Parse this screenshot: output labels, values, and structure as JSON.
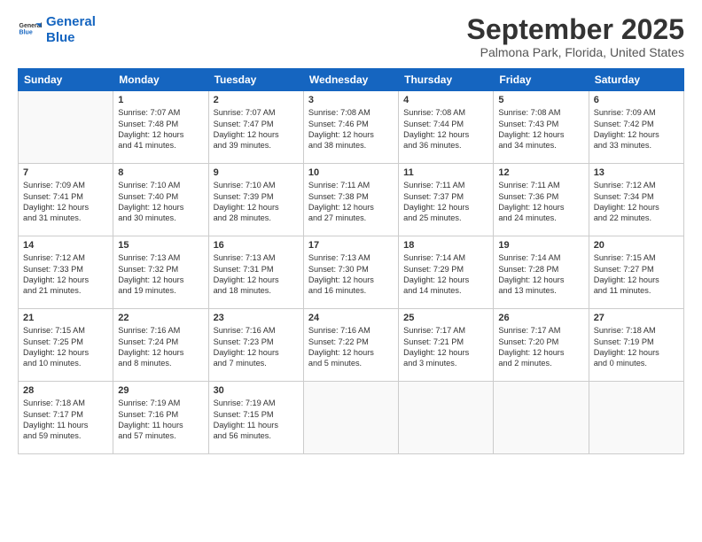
{
  "header": {
    "logo_line1": "General",
    "logo_line2": "Blue",
    "month": "September 2025",
    "location": "Palmona Park, Florida, United States"
  },
  "weekdays": [
    "Sunday",
    "Monday",
    "Tuesday",
    "Wednesday",
    "Thursday",
    "Friday",
    "Saturday"
  ],
  "weeks": [
    [
      {
        "day": "",
        "info": ""
      },
      {
        "day": "1",
        "info": "Sunrise: 7:07 AM\nSunset: 7:48 PM\nDaylight: 12 hours\nand 41 minutes."
      },
      {
        "day": "2",
        "info": "Sunrise: 7:07 AM\nSunset: 7:47 PM\nDaylight: 12 hours\nand 39 minutes."
      },
      {
        "day": "3",
        "info": "Sunrise: 7:08 AM\nSunset: 7:46 PM\nDaylight: 12 hours\nand 38 minutes."
      },
      {
        "day": "4",
        "info": "Sunrise: 7:08 AM\nSunset: 7:44 PM\nDaylight: 12 hours\nand 36 minutes."
      },
      {
        "day": "5",
        "info": "Sunrise: 7:08 AM\nSunset: 7:43 PM\nDaylight: 12 hours\nand 34 minutes."
      },
      {
        "day": "6",
        "info": "Sunrise: 7:09 AM\nSunset: 7:42 PM\nDaylight: 12 hours\nand 33 minutes."
      }
    ],
    [
      {
        "day": "7",
        "info": "Sunrise: 7:09 AM\nSunset: 7:41 PM\nDaylight: 12 hours\nand 31 minutes."
      },
      {
        "day": "8",
        "info": "Sunrise: 7:10 AM\nSunset: 7:40 PM\nDaylight: 12 hours\nand 30 minutes."
      },
      {
        "day": "9",
        "info": "Sunrise: 7:10 AM\nSunset: 7:39 PM\nDaylight: 12 hours\nand 28 minutes."
      },
      {
        "day": "10",
        "info": "Sunrise: 7:11 AM\nSunset: 7:38 PM\nDaylight: 12 hours\nand 27 minutes."
      },
      {
        "day": "11",
        "info": "Sunrise: 7:11 AM\nSunset: 7:37 PM\nDaylight: 12 hours\nand 25 minutes."
      },
      {
        "day": "12",
        "info": "Sunrise: 7:11 AM\nSunset: 7:36 PM\nDaylight: 12 hours\nand 24 minutes."
      },
      {
        "day": "13",
        "info": "Sunrise: 7:12 AM\nSunset: 7:34 PM\nDaylight: 12 hours\nand 22 minutes."
      }
    ],
    [
      {
        "day": "14",
        "info": "Sunrise: 7:12 AM\nSunset: 7:33 PM\nDaylight: 12 hours\nand 21 minutes."
      },
      {
        "day": "15",
        "info": "Sunrise: 7:13 AM\nSunset: 7:32 PM\nDaylight: 12 hours\nand 19 minutes."
      },
      {
        "day": "16",
        "info": "Sunrise: 7:13 AM\nSunset: 7:31 PM\nDaylight: 12 hours\nand 18 minutes."
      },
      {
        "day": "17",
        "info": "Sunrise: 7:13 AM\nSunset: 7:30 PM\nDaylight: 12 hours\nand 16 minutes."
      },
      {
        "day": "18",
        "info": "Sunrise: 7:14 AM\nSunset: 7:29 PM\nDaylight: 12 hours\nand 14 minutes."
      },
      {
        "day": "19",
        "info": "Sunrise: 7:14 AM\nSunset: 7:28 PM\nDaylight: 12 hours\nand 13 minutes."
      },
      {
        "day": "20",
        "info": "Sunrise: 7:15 AM\nSunset: 7:27 PM\nDaylight: 12 hours\nand 11 minutes."
      }
    ],
    [
      {
        "day": "21",
        "info": "Sunrise: 7:15 AM\nSunset: 7:25 PM\nDaylight: 12 hours\nand 10 minutes."
      },
      {
        "day": "22",
        "info": "Sunrise: 7:16 AM\nSunset: 7:24 PM\nDaylight: 12 hours\nand 8 minutes."
      },
      {
        "day": "23",
        "info": "Sunrise: 7:16 AM\nSunset: 7:23 PM\nDaylight: 12 hours\nand 7 minutes."
      },
      {
        "day": "24",
        "info": "Sunrise: 7:16 AM\nSunset: 7:22 PM\nDaylight: 12 hours\nand 5 minutes."
      },
      {
        "day": "25",
        "info": "Sunrise: 7:17 AM\nSunset: 7:21 PM\nDaylight: 12 hours\nand 3 minutes."
      },
      {
        "day": "26",
        "info": "Sunrise: 7:17 AM\nSunset: 7:20 PM\nDaylight: 12 hours\nand 2 minutes."
      },
      {
        "day": "27",
        "info": "Sunrise: 7:18 AM\nSunset: 7:19 PM\nDaylight: 12 hours\nand 0 minutes."
      }
    ],
    [
      {
        "day": "28",
        "info": "Sunrise: 7:18 AM\nSunset: 7:17 PM\nDaylight: 11 hours\nand 59 minutes."
      },
      {
        "day": "29",
        "info": "Sunrise: 7:19 AM\nSunset: 7:16 PM\nDaylight: 11 hours\nand 57 minutes."
      },
      {
        "day": "30",
        "info": "Sunrise: 7:19 AM\nSunset: 7:15 PM\nDaylight: 11 hours\nand 56 minutes."
      },
      {
        "day": "",
        "info": ""
      },
      {
        "day": "",
        "info": ""
      },
      {
        "day": "",
        "info": ""
      },
      {
        "day": "",
        "info": ""
      }
    ]
  ]
}
